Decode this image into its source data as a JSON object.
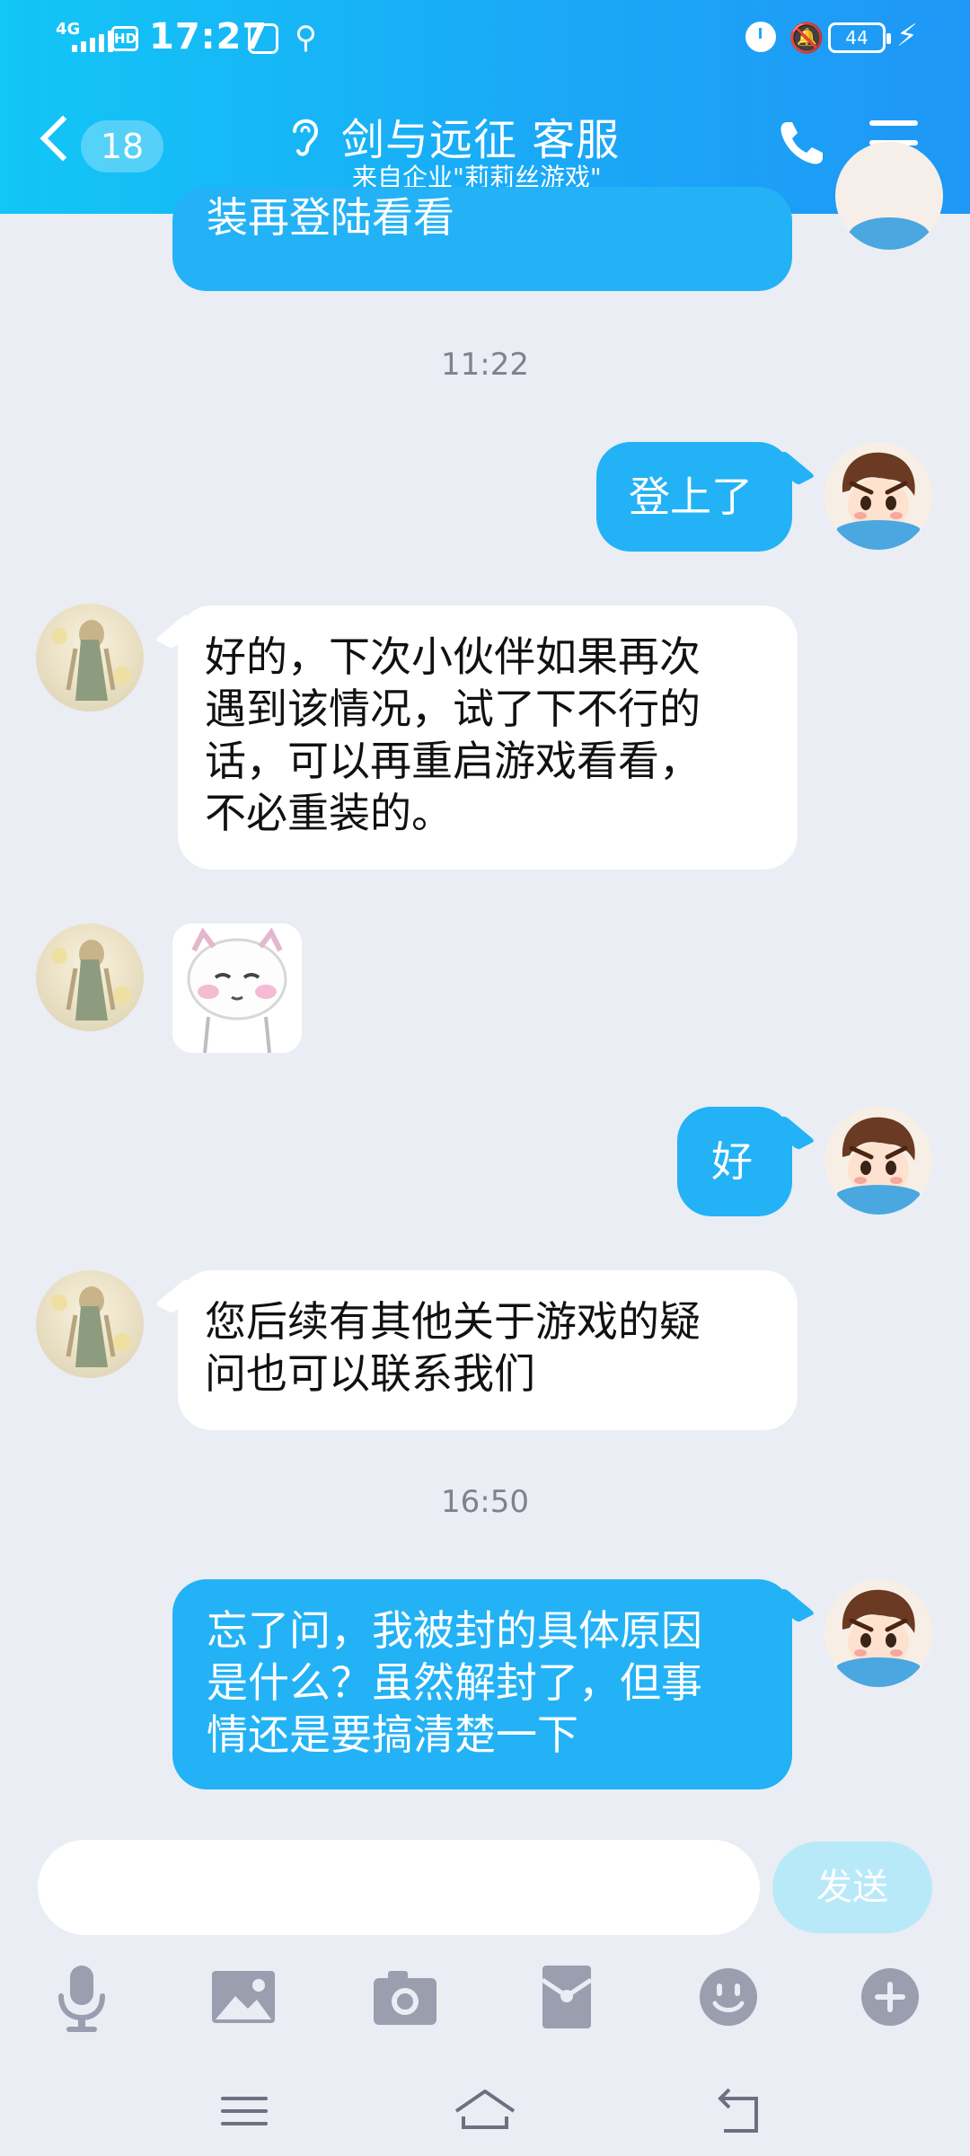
{
  "status_bar": {
    "network": "4G",
    "hd": "HD",
    "time": "17:27",
    "battery": "44"
  },
  "header": {
    "back_count": "18",
    "title": "剑与远征 客服",
    "subtitle": "来自企业\"莉莉丝游戏\""
  },
  "messages": {
    "m0": {
      "side": "out",
      "lines": [
        "装再登陆看看"
      ]
    },
    "time1": "11:22",
    "m1": {
      "side": "out",
      "lines": [
        "登上了"
      ]
    },
    "m2": {
      "side": "in",
      "lines": [
        "好的，下次小伙伴如果再次",
        "遇到该情况，试了下不行的",
        "话，可以再重启游戏看看，",
        "不必重装的。"
      ]
    },
    "m3": {
      "side": "in",
      "type": "sticker"
    },
    "m4": {
      "side": "out",
      "lines": [
        "好"
      ]
    },
    "m5": {
      "side": "in",
      "lines": [
        "您后续有其他关于游戏的疑",
        "问也可以联系我们"
      ]
    },
    "time2": "16:50",
    "m6": {
      "side": "out",
      "lines": [
        "忘了问，我被封的具体原因",
        "是什么？虽然解封了，但事",
        "情还是要搞清楚一下"
      ]
    }
  },
  "composer": {
    "input_value": "",
    "send_label": "发送"
  },
  "icons": {
    "toolbar": [
      "microphone-icon",
      "image-icon",
      "camera-icon",
      "red-packet-icon",
      "emoji-icon",
      "plus-icon"
    ],
    "navbar": [
      "menu-icon",
      "home-icon",
      "back-icon"
    ]
  },
  "colors": {
    "header_gradient_start": "#12c6f6",
    "header_gradient_end": "#1f97f6",
    "outgoing_bubble": "#23b2f6",
    "incoming_bubble": "#ffffff",
    "chat_background": "#eaedf4",
    "timestamp_text": "#7e828e",
    "send_button_disabled": "#b8e9f9",
    "toolbar_icon": "#9a9eaf"
  }
}
